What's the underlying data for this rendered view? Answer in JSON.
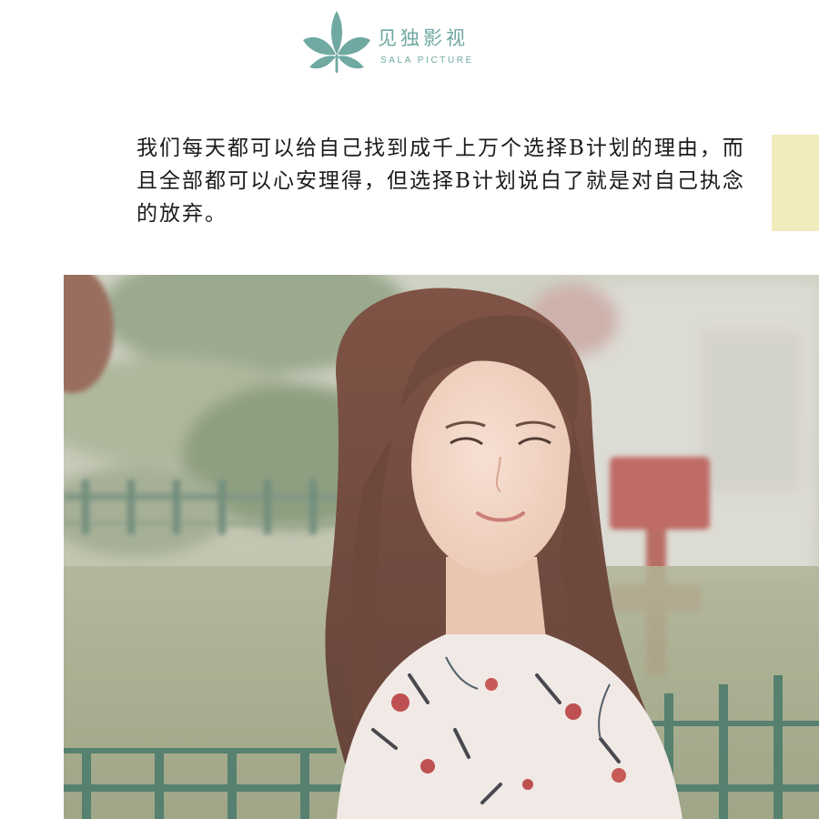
{
  "logo": {
    "name_cn": "见独影视",
    "name_en": "SALA PICTURE",
    "icon": "leaf-flower-icon",
    "color": "#6fa9a2"
  },
  "quote": {
    "text": "我们每天都可以给自己找到成千上万个选择B计划的理由，而且全部都可以心安理得，但选择B计划说白了就是对自己执念的放弃。"
  },
  "note": {
    "color": "#f2ebbc"
  },
  "photo": {
    "subject": "photo"
  }
}
